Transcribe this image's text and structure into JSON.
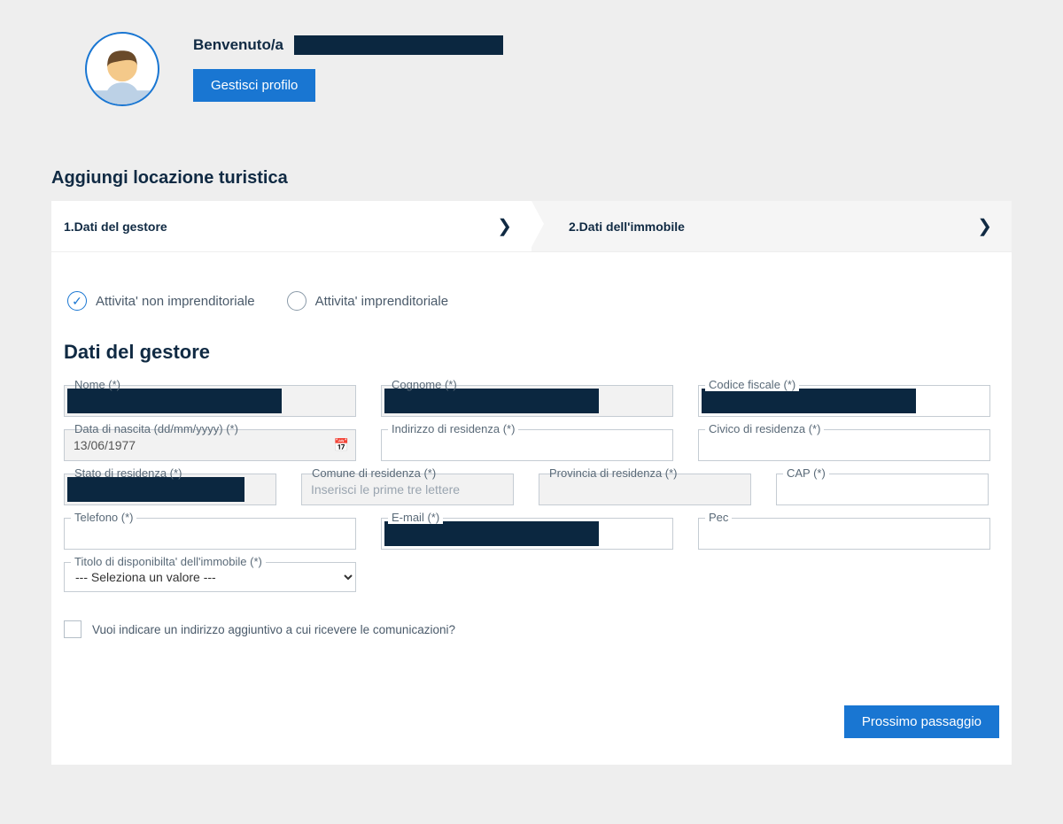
{
  "header": {
    "welcome_label": "Benvenuto/a",
    "manage_profile_button": "Gestisci profilo"
  },
  "page": {
    "title": "Aggiungi locazione turistica"
  },
  "wizard": {
    "step1_label": "1.Dati del gestore",
    "step2_label": "2.Dati dell'immobile",
    "active_step": 1
  },
  "activity_type": {
    "non_imprenditoriale_label": "Attivita' non imprenditoriale",
    "imprenditoriale_label": "Attivita' imprenditoriale",
    "selected": "non_imprenditoriale"
  },
  "form": {
    "section_title": "Dati del gestore",
    "nome": {
      "label": "Nome (*)",
      "value": "[REDACTED]"
    },
    "cognome": {
      "label": "Cognome (*)",
      "value": "[REDACTED]"
    },
    "codice_fiscale": {
      "label": "Codice fiscale (*)",
      "value": "[REDACTED]"
    },
    "data_nascita": {
      "label": "Data di nascita (dd/mm/yyyy) (*)",
      "value": "13/06/1977"
    },
    "indirizzo_residenza": {
      "label": "Indirizzo di residenza (*)",
      "value": ""
    },
    "civico_residenza": {
      "label": "Civico di residenza (*)",
      "value": ""
    },
    "stato_residenza": {
      "label": "Stato di residenza (*)",
      "value": "[REDACTED]"
    },
    "comune_residenza": {
      "label": "Comune di residenza (*)",
      "value": "",
      "placeholder": "Inserisci le prime tre lettere"
    },
    "provincia_residenza": {
      "label": "Provincia di residenza (*)",
      "value": ""
    },
    "cap": {
      "label": "CAP (*)",
      "value": ""
    },
    "telefono": {
      "label": "Telefono (*)",
      "value": ""
    },
    "email": {
      "label": "E-mail (*)",
      "value": "[REDACTED]"
    },
    "pec": {
      "label": "Pec",
      "value": ""
    },
    "titolo_disponibilita": {
      "label": "Titolo di disponibilta' dell'immobile (*)",
      "selected": "--- Seleziona un valore ---"
    },
    "indirizzo_aggiuntivo_checkbox_label": "Vuoi indicare un indirizzo aggiuntivo a cui ricevere le comunicazioni?",
    "indirizzo_aggiuntivo_checked": false
  },
  "footer": {
    "next_button": "Prossimo passaggio"
  }
}
